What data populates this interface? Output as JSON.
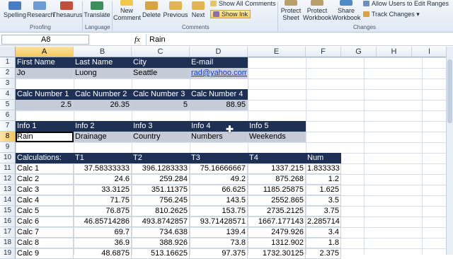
{
  "ribbon": {
    "spelling": "Spelling",
    "research": "Research",
    "thesaurus": "Thesaurus",
    "translate": "Translate",
    "new_comment": [
      "New",
      "Comment"
    ],
    "delete": "Delete",
    "previous": "Previous",
    "next": "Next",
    "show_all_comments": "Show All Comments",
    "show_ink": "Show Ink",
    "protect_sheet": [
      "Protect",
      "Sheet"
    ],
    "protect_workbook": [
      "Protect",
      "Workbook"
    ],
    "share_workbook": [
      "Share",
      "Workbook"
    ],
    "allow_users": "Allow Users to Edit Ranges",
    "track_changes": "Track Changes",
    "groups": {
      "proofing": "Proofing",
      "language": "Language",
      "comments": "Comments",
      "changes": "Changes"
    }
  },
  "formula_bar": {
    "name_box": "A8",
    "fx": "fx",
    "value": "Rain"
  },
  "columns": [
    "A",
    "B",
    "C",
    "D",
    "E",
    "F",
    "G",
    "H",
    "I"
  ],
  "rows": [
    "1",
    "2",
    "3",
    "4",
    "5",
    "6",
    "7",
    "8",
    "9",
    "10",
    "11",
    "12",
    "13",
    "14",
    "15",
    "16",
    "17",
    "18",
    "19"
  ],
  "cells": {
    "r1": [
      "First Name",
      "Last Name",
      "City",
      "E-mail"
    ],
    "r2": [
      "Jo",
      "Luong",
      "Seattle",
      "rad@yahoo.com"
    ],
    "r4": [
      "Calc Number 1",
      "Calc Number 2",
      "Calc Number 3",
      "Calc Number 4"
    ],
    "r5": [
      "2.5",
      "26.35",
      "5",
      "88.95"
    ],
    "r7": [
      "Info 1",
      "Info 2",
      "Info 3",
      "Info 4",
      "Info 5"
    ],
    "r8": [
      "Rain",
      "Drainage",
      "Country",
      "Numbers",
      "Weekends"
    ],
    "r10": [
      "Calculations:",
      "T1",
      "T2",
      "T3",
      "T4",
      "Num"
    ],
    "calc": [
      [
        "Calc 1",
        "37.58333333",
        "396.1283333",
        "75.16666667",
        "1337.215",
        "1.833333"
      ],
      [
        "Calc 2",
        "24.6",
        "259.284",
        "49.2",
        "875.268",
        "1.2"
      ],
      [
        "Calc 3",
        "33.3125",
        "351.11375",
        "66.625",
        "1185.25875",
        "1.625"
      ],
      [
        "Calc 4",
        "71.75",
        "756.245",
        "143.5",
        "2552.865",
        "3.5"
      ],
      [
        "Calc 5",
        "76.875",
        "810.2625",
        "153.75",
        "2735.2125",
        "3.75"
      ],
      [
        "Calc 6",
        "46.85714286",
        "493.8742857",
        "93.71428571",
        "1667.177143",
        "2.285714"
      ],
      [
        "Calc 7",
        "69.7",
        "734.638",
        "139.4",
        "2479.926",
        "3.4"
      ],
      [
        "Calc 8",
        "36.9",
        "388.926",
        "73.8",
        "1312.902",
        "1.8"
      ],
      [
        "Calc 9",
        "48.6875",
        "513.16625",
        "97.375",
        "1732.30125",
        "2.375"
      ]
    ]
  },
  "cursor_glyph": "✚"
}
